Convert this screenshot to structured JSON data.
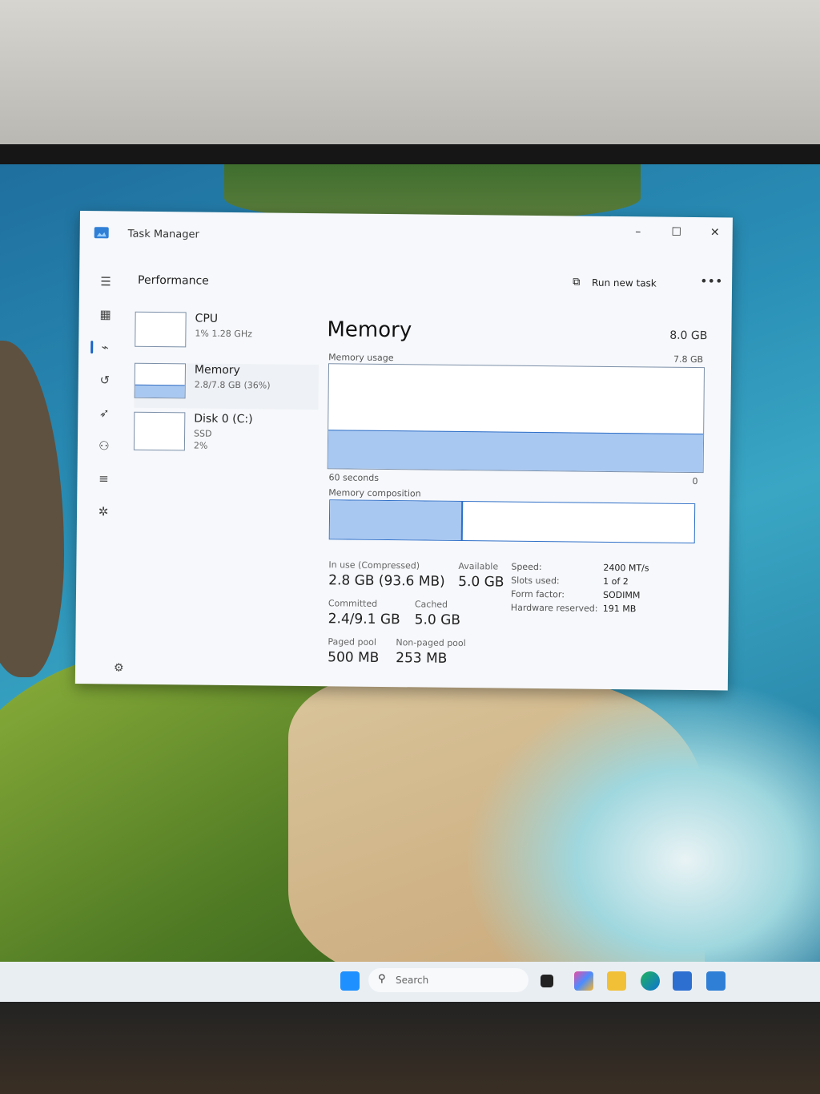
{
  "window": {
    "title": "Task Manager",
    "minimize": "–",
    "maximize": "☐",
    "close": "✕"
  },
  "header": {
    "section_title": "Performance",
    "run_new_task": "Run new task",
    "more": "•••"
  },
  "perf_list": [
    {
      "name": "CPU",
      "sub": "1% 1.28 GHz",
      "sub2": ""
    },
    {
      "name": "Memory",
      "sub": "2.8/7.8 GB (36%)",
      "sub2": ""
    },
    {
      "name": "Disk 0 (C:)",
      "sub": "SSD",
      "sub2": "2%"
    }
  ],
  "memory": {
    "title": "Memory",
    "total": "8.0 GB",
    "usage_label": "Memory usage",
    "usage_max": "7.8 GB",
    "usage_fraction": 0.36,
    "axis_left": "60 seconds",
    "axis_right": "0",
    "composition_label": "Memory composition",
    "composition_in_use_fraction": 0.36,
    "stats": {
      "in_use_label": "In use (Compressed)",
      "in_use_value": "2.8 GB (93.6 MB)",
      "available_label": "Available",
      "available_value": "5.0 GB",
      "committed_label": "Committed",
      "committed_value": "2.4/9.1 GB",
      "cached_label": "Cached",
      "cached_value": "5.0 GB",
      "paged_pool_label": "Paged pool",
      "paged_pool_value": "500 MB",
      "non_paged_pool_label": "Non-paged pool",
      "non_paged_pool_value": "253 MB"
    },
    "specs": [
      {
        "label": "Speed:",
        "value": "2400 MT/s"
      },
      {
        "label": "Slots used:",
        "value": "1 of 2"
      },
      {
        "label": "Form factor:",
        "value": "SODIMM"
      },
      {
        "label": "Hardware reserved:",
        "value": "191 MB"
      }
    ]
  },
  "taskbar": {
    "search_placeholder": "Search"
  },
  "colors": {
    "accent": "#2f6fc7",
    "graph_fill": "#a9c8f1"
  }
}
